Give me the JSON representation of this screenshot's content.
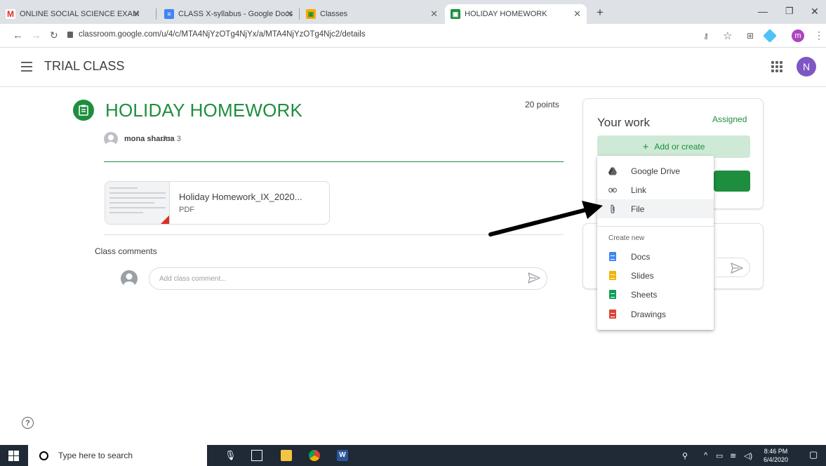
{
  "browser": {
    "tabs": [
      {
        "label": "ONLINE SOCIAL SCIENCE EXAM",
        "icon": "gmail-icon"
      },
      {
        "label": "CLASS X-syllabus - Google Docs",
        "icon": "docs-icon"
      },
      {
        "label": "Classes",
        "icon": "classroom-icon"
      },
      {
        "label": "HOLIDAY HOMEWORK",
        "icon": "classroom-icon",
        "active": true
      }
    ],
    "new_tab": "+",
    "url": "classroom.google.com/u/4/c/MTA4NjYzOTg4NjYx/a/MTA4NjYzOTg4Njc2/details",
    "profile_initial": "m"
  },
  "app": {
    "class_name": "TRIAL CLASS",
    "user_initial": "N"
  },
  "assignment": {
    "title": "HOLIDAY HOMEWORK",
    "points": "20 points",
    "author": "mona sharma",
    "date": "Jun 3",
    "attachment": {
      "name": "Holiday Homework_IX_2020...",
      "type": "PDF"
    },
    "class_comments_label": "Class comments",
    "comment_placeholder": "Add class comment..."
  },
  "your_work": {
    "title": "Your work",
    "status": "Assigned",
    "add_button": "Add or create"
  },
  "menu": {
    "items": [
      {
        "label": "Google Drive",
        "icon": "google-drive-icon"
      },
      {
        "label": "Link",
        "icon": "link-icon"
      },
      {
        "label": "File",
        "icon": "paperclip-icon",
        "highlighted": true
      }
    ],
    "create_new_label": "Create new",
    "create_items": [
      {
        "label": "Docs",
        "icon": "docs-icon",
        "color": "#4285f4"
      },
      {
        "label": "Slides",
        "icon": "slides-icon",
        "color": "#f4b400"
      },
      {
        "label": "Sheets",
        "icon": "sheets-icon",
        "color": "#0f9d58"
      },
      {
        "label": "Drawings",
        "icon": "drawings-icon",
        "color": "#db4437"
      }
    ]
  },
  "help": "?",
  "taskbar": {
    "search_placeholder": "Type here to search",
    "time": "8:46 PM",
    "date": "6/4/2020"
  },
  "colors": {
    "classroom_green": "#1e8e3e",
    "add_button_bg": "#ceead6",
    "avatar_purple": "#7e57c2"
  }
}
